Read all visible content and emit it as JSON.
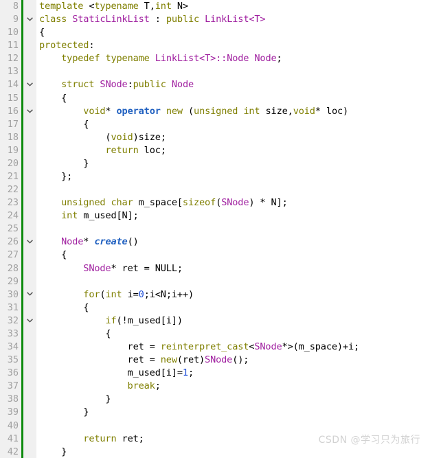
{
  "editor": {
    "language": "C++",
    "first_line_number": 8,
    "last_line_number": 42,
    "gutter_background": "#f0f0f0",
    "code_background": "#ffffff",
    "change_bar_color": "#0e8a0e",
    "linenumber_color": "#a0a0a0"
  },
  "theme": {
    "keyword": "#7f7f00",
    "class_name": "#a020a0",
    "operator_keyword": "#2060c0",
    "function_name": "#2060c0",
    "number": "#1f4fd8",
    "plain": "#000000"
  },
  "watermark": {
    "text": "CSDN @学习只为旅行",
    "color": "#d2d2d2"
  },
  "fold_icon": "chevron-down-icon",
  "lines": [
    {
      "number": "8",
      "fold": false,
      "indent": 0,
      "text": "template <typename T,int N>",
      "tokens": [
        {
          "t": "template",
          "c": "t-kw"
        },
        {
          "t": " <",
          "c": "t-punct"
        },
        {
          "t": "typename",
          "c": "t-kw"
        },
        {
          "t": " T,",
          "c": "t-plain"
        },
        {
          "t": "int",
          "c": "t-type"
        },
        {
          "t": " N>",
          "c": "t-plain"
        }
      ]
    },
    {
      "number": "9",
      "fold": true,
      "indent": 0,
      "text": "class StaticLinkList : public LinkList<T>",
      "tokens": [
        {
          "t": "class",
          "c": "t-kw"
        },
        {
          "t": " ",
          "c": "t-plain"
        },
        {
          "t": "StaticLinkList",
          "c": "t-cls"
        },
        {
          "t": " : ",
          "c": "t-plain"
        },
        {
          "t": "public",
          "c": "t-kw"
        },
        {
          "t": " ",
          "c": "t-plain"
        },
        {
          "t": "LinkList<T>",
          "c": "t-cls"
        }
      ]
    },
    {
      "number": "10",
      "fold": false,
      "indent": 0,
      "text": "{",
      "tokens": [
        {
          "t": "{",
          "c": "t-punct"
        }
      ]
    },
    {
      "number": "11",
      "fold": false,
      "indent": 0,
      "text": "protected:",
      "tokens": [
        {
          "t": "protected",
          "c": "t-kw"
        },
        {
          "t": ":",
          "c": "t-punct"
        }
      ]
    },
    {
      "number": "12",
      "fold": false,
      "indent": 1,
      "text": "    typedef typename LinkList<T>::Node Node;",
      "tokens": [
        {
          "t": "    ",
          "c": "t-plain"
        },
        {
          "t": "typedef",
          "c": "t-kw"
        },
        {
          "t": " ",
          "c": "t-plain"
        },
        {
          "t": "typename",
          "c": "t-kw"
        },
        {
          "t": " ",
          "c": "t-plain"
        },
        {
          "t": "LinkList<T>::Node Node",
          "c": "t-cls"
        },
        {
          "t": ";",
          "c": "t-punct"
        }
      ]
    },
    {
      "number": "13",
      "fold": false,
      "indent": 0,
      "text": "",
      "tokens": []
    },
    {
      "number": "14",
      "fold": true,
      "indent": 1,
      "text": "    struct SNode:public Node",
      "tokens": [
        {
          "t": "    ",
          "c": "t-plain"
        },
        {
          "t": "struct",
          "c": "t-kw"
        },
        {
          "t": " ",
          "c": "t-plain"
        },
        {
          "t": "SNode",
          "c": "t-cls"
        },
        {
          "t": ":",
          "c": "t-punct"
        },
        {
          "t": "public",
          "c": "t-kw"
        },
        {
          "t": " ",
          "c": "t-plain"
        },
        {
          "t": "Node",
          "c": "t-cls"
        }
      ]
    },
    {
      "number": "15",
      "fold": false,
      "indent": 1,
      "text": "    {",
      "tokens": [
        {
          "t": "    {",
          "c": "t-punct"
        }
      ]
    },
    {
      "number": "16",
      "fold": true,
      "indent": 2,
      "text": "        void* operator new (unsigned int size,void* loc)",
      "tokens": [
        {
          "t": "        ",
          "c": "t-plain"
        },
        {
          "t": "void",
          "c": "t-type"
        },
        {
          "t": "*",
          "c": "t-punct"
        },
        {
          "t": " ",
          "c": "t-plain"
        },
        {
          "t": "operator",
          "c": "t-op"
        },
        {
          "t": " ",
          "c": "t-plain"
        },
        {
          "t": "new",
          "c": "t-kw"
        },
        {
          "t": " (",
          "c": "t-punct"
        },
        {
          "t": "unsigned",
          "c": "t-type"
        },
        {
          "t": " ",
          "c": "t-plain"
        },
        {
          "t": "int",
          "c": "t-type"
        },
        {
          "t": " size,",
          "c": "t-plain"
        },
        {
          "t": "void",
          "c": "t-type"
        },
        {
          "t": "*",
          "c": "t-punct"
        },
        {
          "t": " loc)",
          "c": "t-plain"
        }
      ]
    },
    {
      "number": "17",
      "fold": false,
      "indent": 2,
      "text": "        {",
      "tokens": [
        {
          "t": "        {",
          "c": "t-punct"
        }
      ]
    },
    {
      "number": "18",
      "fold": false,
      "indent": 3,
      "text": "            (void)size;",
      "tokens": [
        {
          "t": "            (",
          "c": "t-punct"
        },
        {
          "t": "void",
          "c": "t-type"
        },
        {
          "t": ")size;",
          "c": "t-plain"
        }
      ]
    },
    {
      "number": "19",
      "fold": false,
      "indent": 3,
      "text": "            return loc;",
      "tokens": [
        {
          "t": "            ",
          "c": "t-plain"
        },
        {
          "t": "return",
          "c": "t-kw"
        },
        {
          "t": " loc;",
          "c": "t-plain"
        }
      ]
    },
    {
      "number": "20",
      "fold": false,
      "indent": 2,
      "text": "        }",
      "tokens": [
        {
          "t": "        }",
          "c": "t-punct"
        }
      ]
    },
    {
      "number": "21",
      "fold": false,
      "indent": 1,
      "text": "    };",
      "tokens": [
        {
          "t": "    };",
          "c": "t-punct"
        }
      ]
    },
    {
      "number": "22",
      "fold": false,
      "indent": 0,
      "text": "",
      "tokens": []
    },
    {
      "number": "23",
      "fold": false,
      "indent": 1,
      "text": "    unsigned char m_space[sizeof(SNode) * N];",
      "tokens": [
        {
          "t": "    ",
          "c": "t-plain"
        },
        {
          "t": "unsigned",
          "c": "t-type"
        },
        {
          "t": " ",
          "c": "t-plain"
        },
        {
          "t": "char",
          "c": "t-type"
        },
        {
          "t": " m_space[",
          "c": "t-plain"
        },
        {
          "t": "sizeof",
          "c": "t-kw"
        },
        {
          "t": "(",
          "c": "t-punct"
        },
        {
          "t": "SNode",
          "c": "t-cls"
        },
        {
          "t": ") * N];",
          "c": "t-plain"
        }
      ]
    },
    {
      "number": "24",
      "fold": false,
      "indent": 1,
      "text": "    int m_used[N];",
      "tokens": [
        {
          "t": "    ",
          "c": "t-plain"
        },
        {
          "t": "int",
          "c": "t-type"
        },
        {
          "t": " m_used[N];",
          "c": "t-plain"
        }
      ]
    },
    {
      "number": "25",
      "fold": false,
      "indent": 0,
      "text": "",
      "tokens": []
    },
    {
      "number": "26",
      "fold": true,
      "indent": 1,
      "text": "    Node* create()",
      "tokens": [
        {
          "t": "    ",
          "c": "t-plain"
        },
        {
          "t": "Node",
          "c": "t-cls"
        },
        {
          "t": "*",
          "c": "t-punct"
        },
        {
          "t": " ",
          "c": "t-plain"
        },
        {
          "t": "create",
          "c": "t-fn"
        },
        {
          "t": "()",
          "c": "t-punct"
        }
      ]
    },
    {
      "number": "27",
      "fold": false,
      "indent": 1,
      "text": "    {",
      "tokens": [
        {
          "t": "    {",
          "c": "t-punct"
        }
      ]
    },
    {
      "number": "28",
      "fold": false,
      "indent": 2,
      "text": "        SNode* ret = NULL;",
      "tokens": [
        {
          "t": "        ",
          "c": "t-plain"
        },
        {
          "t": "SNode",
          "c": "t-cls"
        },
        {
          "t": "*",
          "c": "t-punct"
        },
        {
          "t": " ret = NULL;",
          "c": "t-plain"
        }
      ]
    },
    {
      "number": "29",
      "fold": false,
      "indent": 0,
      "text": "",
      "tokens": []
    },
    {
      "number": "30",
      "fold": true,
      "indent": 2,
      "text": "        for(int i=0;i<N;i++)",
      "tokens": [
        {
          "t": "        ",
          "c": "t-plain"
        },
        {
          "t": "for",
          "c": "t-kw"
        },
        {
          "t": "(",
          "c": "t-punct"
        },
        {
          "t": "int",
          "c": "t-type"
        },
        {
          "t": " i=",
          "c": "t-plain"
        },
        {
          "t": "0",
          "c": "t-num"
        },
        {
          "t": ";i<N;i++)",
          "c": "t-plain"
        }
      ]
    },
    {
      "number": "31",
      "fold": false,
      "indent": 2,
      "text": "        {",
      "tokens": [
        {
          "t": "        {",
          "c": "t-punct"
        }
      ]
    },
    {
      "number": "32",
      "fold": true,
      "indent": 3,
      "text": "            if(!m_used[i])",
      "tokens": [
        {
          "t": "            ",
          "c": "t-plain"
        },
        {
          "t": "if",
          "c": "t-kw"
        },
        {
          "t": "(!m_used[i])",
          "c": "t-plain"
        }
      ]
    },
    {
      "number": "33",
      "fold": false,
      "indent": 3,
      "text": "            {",
      "tokens": [
        {
          "t": "            {",
          "c": "t-punct"
        }
      ]
    },
    {
      "number": "34",
      "fold": false,
      "indent": 4,
      "text": "                ret = reinterpret_cast<SNode*>(m_space)+i;",
      "tokens": [
        {
          "t": "                ret = ",
          "c": "t-plain"
        },
        {
          "t": "reinterpret_cast",
          "c": "t-kw"
        },
        {
          "t": "<",
          "c": "t-punct"
        },
        {
          "t": "SNode",
          "c": "t-cls"
        },
        {
          "t": "*",
          "c": "t-punct"
        },
        {
          "t": ">(m_space)+i;",
          "c": "t-plain"
        }
      ]
    },
    {
      "number": "35",
      "fold": false,
      "indent": 4,
      "text": "                ret = new(ret)SNode();",
      "tokens": [
        {
          "t": "                ret = ",
          "c": "t-plain"
        },
        {
          "t": "new",
          "c": "t-kw"
        },
        {
          "t": "(ret)",
          "c": "t-plain"
        },
        {
          "t": "SNode",
          "c": "t-cls"
        },
        {
          "t": "();",
          "c": "t-punct"
        }
      ]
    },
    {
      "number": "36",
      "fold": false,
      "indent": 4,
      "text": "                m_used[i]=1;",
      "tokens": [
        {
          "t": "                m_used[i]=",
          "c": "t-plain"
        },
        {
          "t": "1",
          "c": "t-num"
        },
        {
          "t": ";",
          "c": "t-punct"
        }
      ]
    },
    {
      "number": "37",
      "fold": false,
      "indent": 4,
      "text": "                break;",
      "tokens": [
        {
          "t": "                ",
          "c": "t-plain"
        },
        {
          "t": "break",
          "c": "t-kw"
        },
        {
          "t": ";",
          "c": "t-punct"
        }
      ]
    },
    {
      "number": "38",
      "fold": false,
      "indent": 3,
      "text": "            }",
      "tokens": [
        {
          "t": "            }",
          "c": "t-punct"
        }
      ]
    },
    {
      "number": "39",
      "fold": false,
      "indent": 2,
      "text": "        }",
      "tokens": [
        {
          "t": "        }",
          "c": "t-punct"
        }
      ]
    },
    {
      "number": "40",
      "fold": false,
      "indent": 0,
      "text": "",
      "tokens": []
    },
    {
      "number": "41",
      "fold": false,
      "indent": 2,
      "text": "        return ret;",
      "tokens": [
        {
          "t": "        ",
          "c": "t-plain"
        },
        {
          "t": "return",
          "c": "t-kw"
        },
        {
          "t": " ret;",
          "c": "t-plain"
        }
      ]
    },
    {
      "number": "42",
      "fold": false,
      "indent": 1,
      "text": "    }",
      "tokens": [
        {
          "t": "    }",
          "c": "t-punct"
        }
      ]
    }
  ]
}
